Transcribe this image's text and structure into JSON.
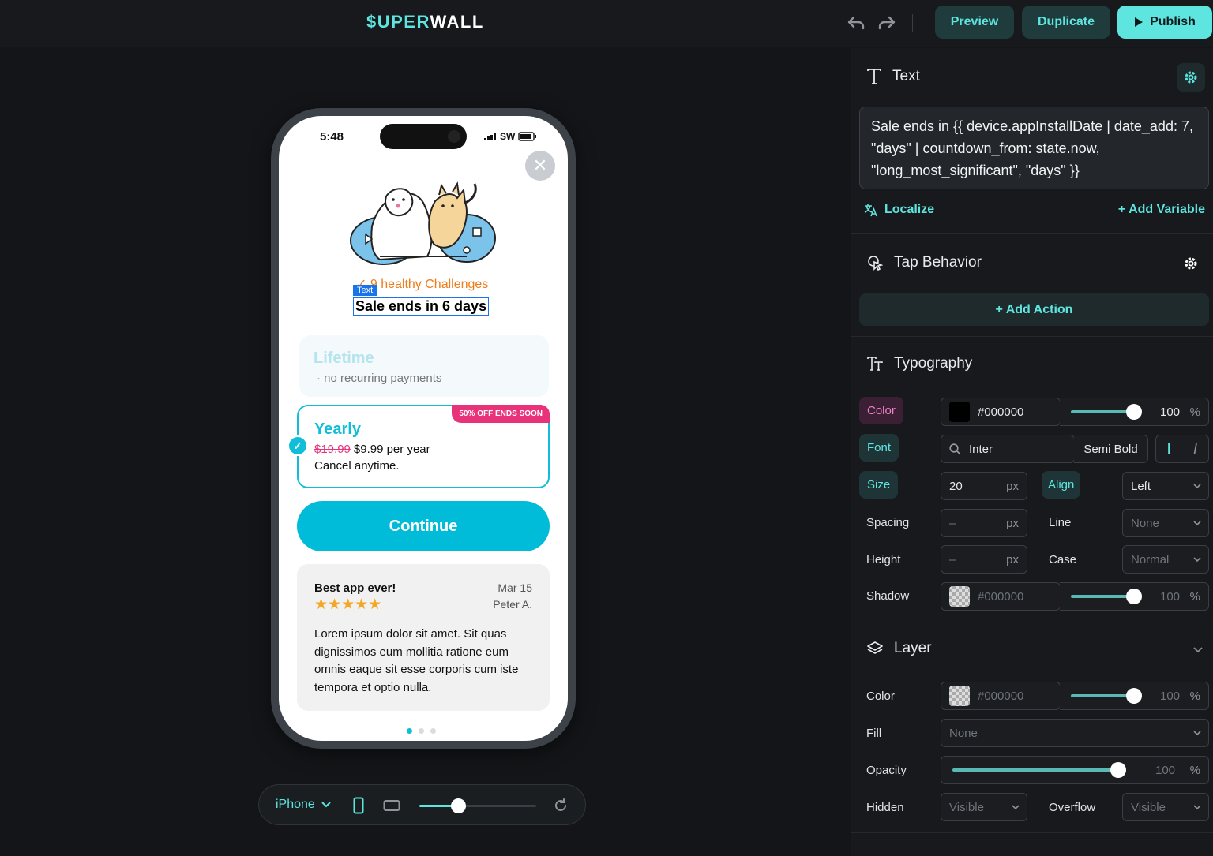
{
  "app": {
    "logo_accent": "$UPER",
    "logo_rest": "WALL",
    "accent_color": "#5ee5e0",
    "preview_label": "Preview",
    "duplicate_label": "Duplicate",
    "publish_label": "Publish"
  },
  "phone": {
    "time": "5:48",
    "carrier": "SW",
    "close_glyph": "✕",
    "challenge_text": "✓ 9 healthy Challenges",
    "selection_tag": "Text",
    "selected_text": "Sale ends in 6 days",
    "lifetime": {
      "title": "Lifetime",
      "subtitle": "· no recurring payments"
    },
    "yearly": {
      "badge": "50% OFF ENDS SOON",
      "title": "Yearly",
      "old_price": "$19.99",
      "price": "$9.99 per year",
      "note": "Cancel anytime."
    },
    "continue_label": "Continue",
    "review": {
      "title": "Best app ever!",
      "date": "Mar 15",
      "author": "Peter A.",
      "stars": "★★★★★",
      "rating": 5,
      "body": "Lorem ipsum dolor sit amet. Sit quas dignissimos eum mollitia ratione eum omnis eaque sit esse corporis cum iste tempora et optio nulla."
    },
    "page_dots": 3,
    "active_dot": 1
  },
  "device_bar": {
    "device_label": "iPhone",
    "zoom_level": 0.33
  },
  "panel": {
    "text_section": {
      "title": "Text",
      "value": "Sale ends in {{ device.appInstallDate | date_add: 7, \"days\" | countdown_from: state.now, \"long_most_significant\", \"days\"  }}",
      "localize_label": "Localize",
      "add_variable_label": "+ Add Variable"
    },
    "tap_section": {
      "title": "Tap Behavior",
      "add_action_label": "+ Add Action"
    },
    "typography": {
      "title": "Typography",
      "color_label": "Color",
      "color_value": "#000000",
      "color_opacity": "100",
      "color_slider": 1.0,
      "pct": "%",
      "font_label": "Font",
      "font_value": "Inter",
      "font_weight": "Semi Bold",
      "size_label": "Size",
      "size_value": "20",
      "px": "px",
      "align_label": "Align",
      "align_value": "Left",
      "spacing_label": "Spacing",
      "spacing_value": "–",
      "line_label": "Line",
      "line_value": "None",
      "height_label": "Height",
      "height_value": "–",
      "case_label": "Case",
      "case_value": "Normal",
      "shadow_label": "Shadow",
      "shadow_value": "#000000",
      "shadow_opacity": "100",
      "shadow_slider": 1.0
    },
    "layer": {
      "title": "Layer",
      "color_label": "Color",
      "color_value": "#000000",
      "color_opacity": "100",
      "color_slider": 1.0,
      "fill_label": "Fill",
      "fill_value": "None",
      "opacity_label": "Opacity",
      "opacity_value": "100",
      "opacity_slider": 1.0,
      "hidden_label": "Hidden",
      "hidden_value": "Visible",
      "overflow_label": "Overflow",
      "overflow_value": "Visible"
    }
  }
}
